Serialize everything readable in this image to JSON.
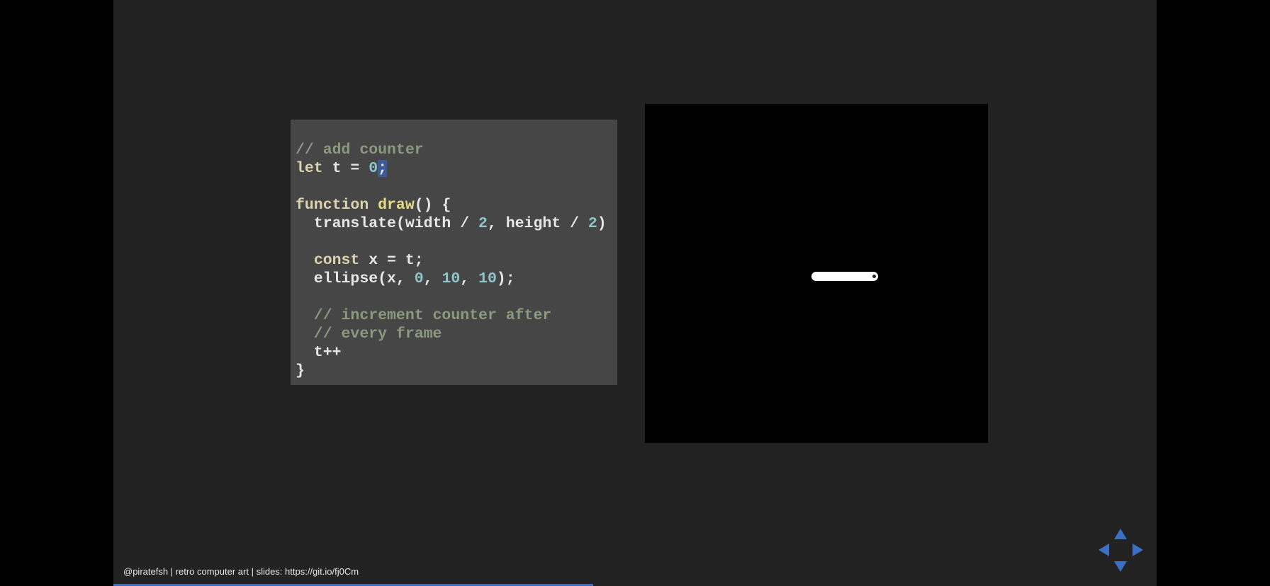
{
  "code": {
    "lines": [
      [
        {
          "t": "// add counter",
          "c": "c"
        }
      ],
      [
        {
          "t": "let",
          "c": "k"
        },
        {
          "t": " t = "
        },
        {
          "t": "0",
          "c": "n"
        },
        {
          "t": ";",
          "c": "sel"
        }
      ],
      [],
      [
        {
          "t": "function",
          "c": "k"
        },
        {
          "t": " "
        },
        {
          "t": "draw",
          "c": "f"
        },
        {
          "t": "() {"
        }
      ],
      [
        {
          "t": "  translate(width / "
        },
        {
          "t": "2",
          "c": "n"
        },
        {
          "t": ", height / "
        },
        {
          "t": "2",
          "c": "n"
        },
        {
          "t": ")"
        }
      ],
      [],
      [
        {
          "t": "  "
        },
        {
          "t": "const",
          "c": "k"
        },
        {
          "t": " x = t;"
        }
      ],
      [
        {
          "t": "  ellipse(x, "
        },
        {
          "t": "0",
          "c": "n"
        },
        {
          "t": ", "
        },
        {
          "t": "10",
          "c": "n"
        },
        {
          "t": ", "
        },
        {
          "t": "10",
          "c": "n"
        },
        {
          "t": ");"
        }
      ],
      [],
      [
        {
          "t": "  // increment counter after",
          "c": "c"
        }
      ],
      [
        {
          "t": "  // every frame",
          "c": "c"
        }
      ],
      [
        {
          "t": "  t++"
        }
      ],
      [
        {
          "t": "}"
        }
      ]
    ]
  },
  "footer": {
    "text": "@piratefsh | retro computer art | slides: https://git.io/fj0Cm"
  },
  "progress": {
    "fraction": 0.46
  },
  "nav": {
    "color": "#3b6fc4",
    "icons": [
      "arrow-up-icon",
      "arrow-left-icon",
      "arrow-right-icon",
      "arrow-down-icon"
    ]
  }
}
